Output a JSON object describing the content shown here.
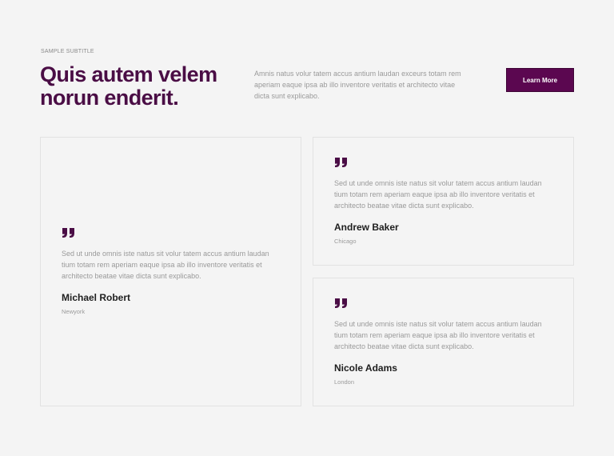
{
  "header": {
    "subtitle": "SAMPLE SUBTITLE",
    "title": "Quis autem velem norun enderit.",
    "description": "Amnis natus volur tatem accus antium laudan exceurs totam rem aperiam eaque ipsa ab illo inventore veritatis et architecto vitae dicta sunt explicabo.",
    "cta_label": "Learn More"
  },
  "colors": {
    "accent": "#5b0750",
    "heading": "#4a0d45",
    "background": "#f4f4f4"
  },
  "testimonials": [
    {
      "quote": "Sed ut unde omnis iste natus sit volur tatem accus antium laudan tium totam rem aperiam eaque ipsa ab illo inventore veritatis et architecto beatae vitae dicta sunt explicabo.",
      "name": "Michael Robert",
      "city": "Newyork",
      "icon": "quote-icon"
    },
    {
      "quote": "Sed ut unde omnis iste natus sit volur tatem accus antium laudan tium totam rem aperiam eaque ipsa ab illo inventore veritatis et architecto beatae vitae dicta sunt explicabo.",
      "name": "Andrew Baker",
      "city": "Chicago",
      "icon": "quote-icon"
    },
    {
      "quote": "Sed ut unde omnis iste natus sit volur tatem accus antium laudan tium totam rem aperiam eaque ipsa ab illo inventore veritatis et architecto beatae vitae dicta sunt explicabo.",
      "name": "Nicole Adams",
      "city": "London",
      "icon": "quote-icon"
    }
  ]
}
